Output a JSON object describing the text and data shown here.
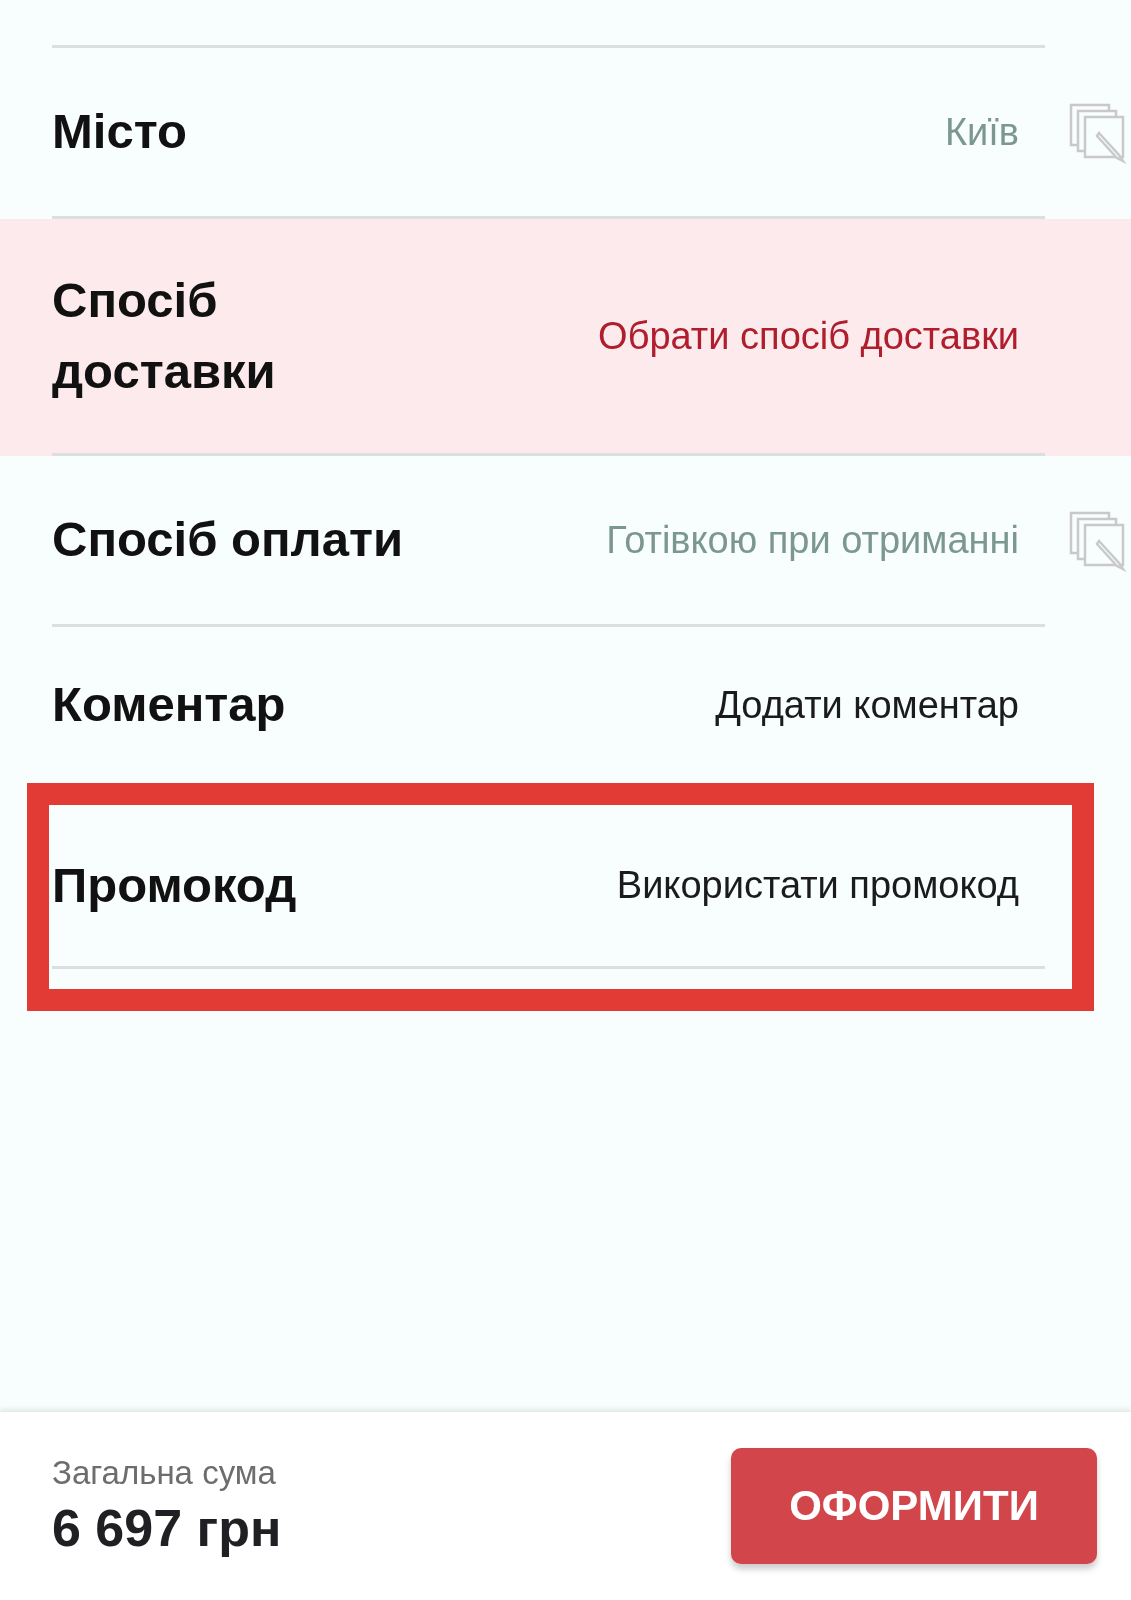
{
  "rows": [
    {
      "label": "Місто",
      "value": "Київ",
      "kind": "muted",
      "editable": true,
      "highlighted": false
    },
    {
      "label": "Спосіб доставки",
      "value": "Обрати спосіб доставки",
      "kind": "error",
      "editable": false,
      "highlighted": false
    },
    {
      "label": "Спосіб оплати",
      "value": "Готівкою при отриманні",
      "kind": "muted",
      "editable": true,
      "highlighted": false
    },
    {
      "label": "Коментар",
      "value": "Додати коментар",
      "kind": "action",
      "editable": false,
      "highlighted": false
    },
    {
      "label": "Промокод",
      "value": "Використати промокод",
      "kind": "action",
      "editable": false,
      "highlighted": true
    }
  ],
  "footer": {
    "total_label": "Загальна сума",
    "total": "6 697 грн",
    "button": "ОФОРМИТИ"
  }
}
